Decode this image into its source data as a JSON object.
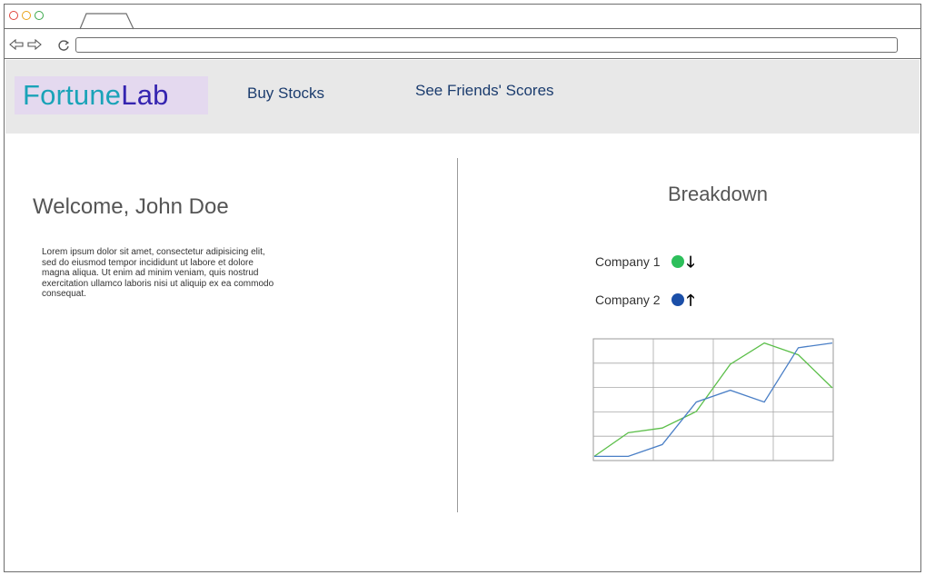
{
  "browser": {
    "url": ""
  },
  "app": {
    "logo_part1": "Fortune",
    "logo_part2": "Lab",
    "nav": {
      "buy_stocks": "Buy Stocks",
      "friends_scores": "See Friends' Scores"
    }
  },
  "welcome": {
    "title": "Welcome, John Doe",
    "body": "Lorem ipsum dolor sit amet, consectetur adipisicing elit, sed do eiusmod tempor incididunt ut labore et dolore magna aliqua. Ut enim ad minim veniam, quis nostrud exercitation ullamco laboris nisi ut aliquip ex ea commodo consequat."
  },
  "breakdown": {
    "title": "Breakdown",
    "companies": [
      {
        "name": "Company 1",
        "color": "#2dbf5b",
        "trend": "down",
        "arrow": "🡓"
      },
      {
        "name": "Company 2",
        "color": "#1b4fa8",
        "trend": "up",
        "arrow": "🡑"
      }
    ]
  },
  "chart_data": {
    "type": "line",
    "title": "",
    "xlabel": "",
    "ylabel": "",
    "grid": true,
    "x": [
      0,
      1,
      2,
      3,
      4,
      5,
      6,
      7,
      8
    ],
    "ylim": [
      0,
      5
    ],
    "series": [
      {
        "color": "#5cbf4a",
        "values": [
          0.1,
          1.1,
          1.3,
          2.0,
          4.0,
          4.9,
          4.4,
          3.0,
          null
        ]
      },
      {
        "color": "#4a7fc6",
        "values": [
          0.1,
          0.1,
          0.6,
          2.4,
          2.9,
          2.4,
          4.7,
          4.9,
          null
        ]
      }
    ]
  }
}
